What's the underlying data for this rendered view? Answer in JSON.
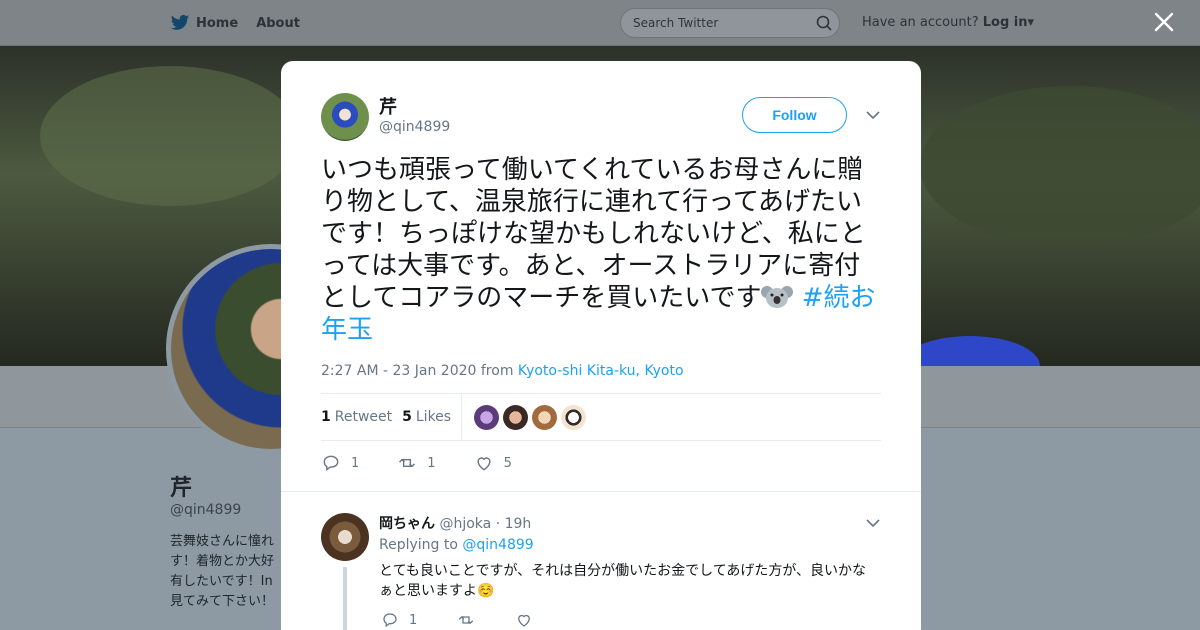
{
  "background": {
    "nav": {
      "home": "Home",
      "about": "About"
    },
    "search": {
      "placeholder": "Search Twitter"
    },
    "account": {
      "prompt": "Have an account?",
      "login": "Log in"
    },
    "profile": {
      "name": "芹",
      "handle": "@qin4899",
      "bio": "芸舞妓さんに憧れ す！着物とか大好 有したいです！In 見てみて下さい！"
    }
  },
  "tweet": {
    "author": {
      "name": "芹",
      "handle": "@qin4899"
    },
    "follow_label": "Follow",
    "text": "いつも頑張って働いてくれているお母さんに贈り物として、温泉旅行に連れて行ってあげたいです！ちっぽけな望かもしれないけど、私にとっては大事です。あと、オーストラリアに寄付としてコアラのマーチを買いたいです",
    "hashtag": "#続お年玉",
    "timestamp": "2:27 AM - 23 Jan 2020",
    "from_label": "from",
    "location": "Kyoto-shi Kita-ku, Kyoto",
    "stats": {
      "retweets": "1",
      "retweet_label": "Retweet",
      "likes": "5",
      "likes_label": "Likes"
    },
    "actions": {
      "replies": "1",
      "retweets": "1",
      "likes": "5"
    }
  },
  "reply": {
    "name": "岡ちゃん",
    "handle": "@hjoka",
    "time": "· 19h",
    "replying_label": "Replying to",
    "replying_to": "@qin4899",
    "text": "とても良いことですが、それは自分が働いたお金でしてあげた方が、良いかなぁと思いますよ☺️",
    "actions": {
      "replies": "1"
    }
  },
  "colors": {
    "accent": "#1da1f2",
    "text": "#14171a",
    "muted": "#657786"
  }
}
